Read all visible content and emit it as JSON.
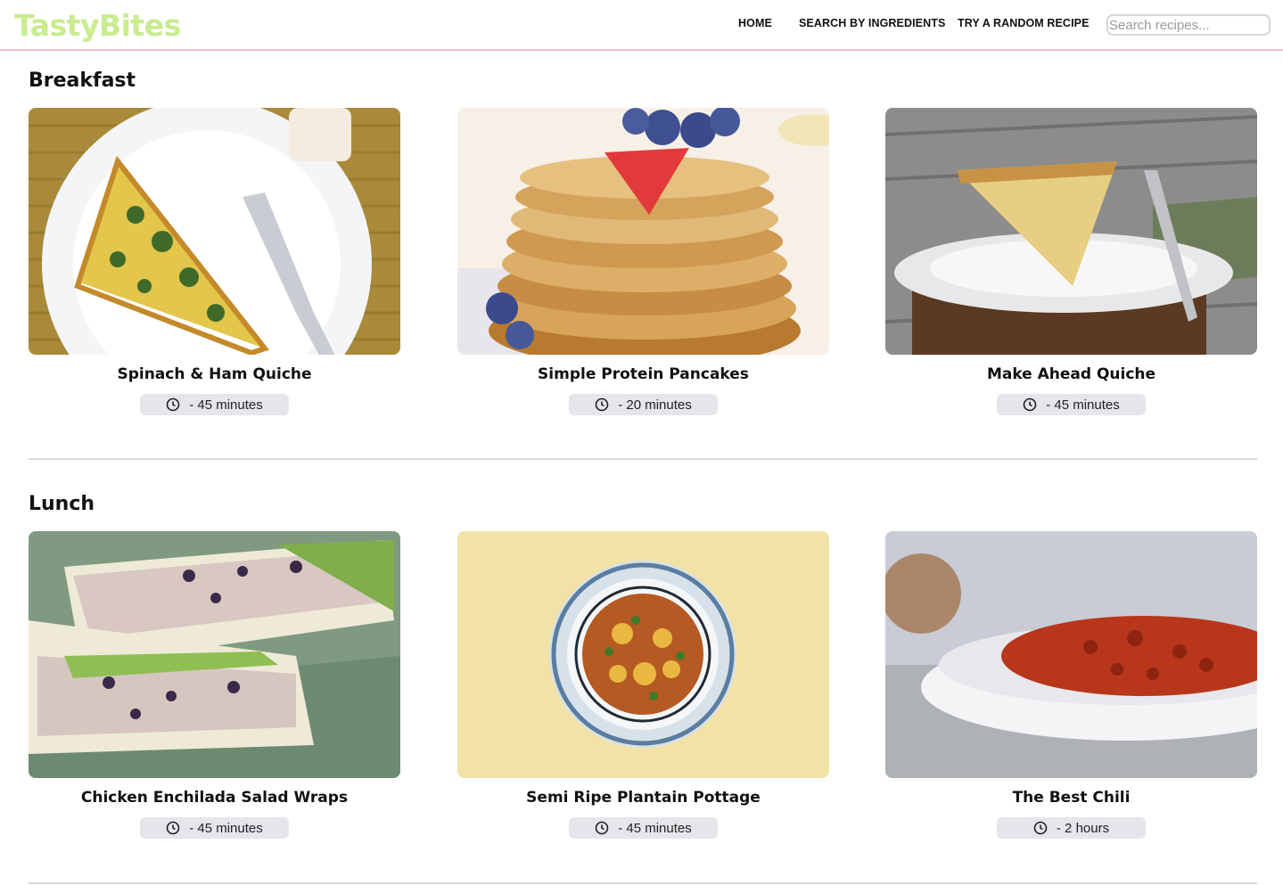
{
  "app": {
    "logo": "TastyBites",
    "brand_color": "#c8ec8e",
    "accent_border": "#f1c6cc"
  },
  "nav": {
    "home": "HOME",
    "search_by_ingredients": "SEARCH BY INGREDIENTS",
    "random_recipe": "TRY A RANDOM RECIPE"
  },
  "search": {
    "placeholder": "Search recipes...",
    "value": ""
  },
  "sections": [
    {
      "title": "Breakfast",
      "recipes": [
        {
          "name": "Spinach & Ham Quiche",
          "time": "- 45 minutes",
          "icon": "clock-icon"
        },
        {
          "name": "Simple Protein Pancakes",
          "time": "- 20 minutes",
          "icon": "clock-icon"
        },
        {
          "name": "Make Ahead Quiche",
          "time": "- 45 minutes",
          "icon": "clock-icon"
        }
      ]
    },
    {
      "title": "Lunch",
      "recipes": [
        {
          "name": "Chicken Enchilada Salad Wraps",
          "time": "- 45 minutes",
          "icon": "clock-icon"
        },
        {
          "name": "Semi Ripe Plantain Pottage",
          "time": "- 45 minutes",
          "icon": "clock-icon"
        },
        {
          "name": "The Best Chili",
          "time": "- 2 hours",
          "icon": "clock-icon"
        }
      ]
    }
  ]
}
